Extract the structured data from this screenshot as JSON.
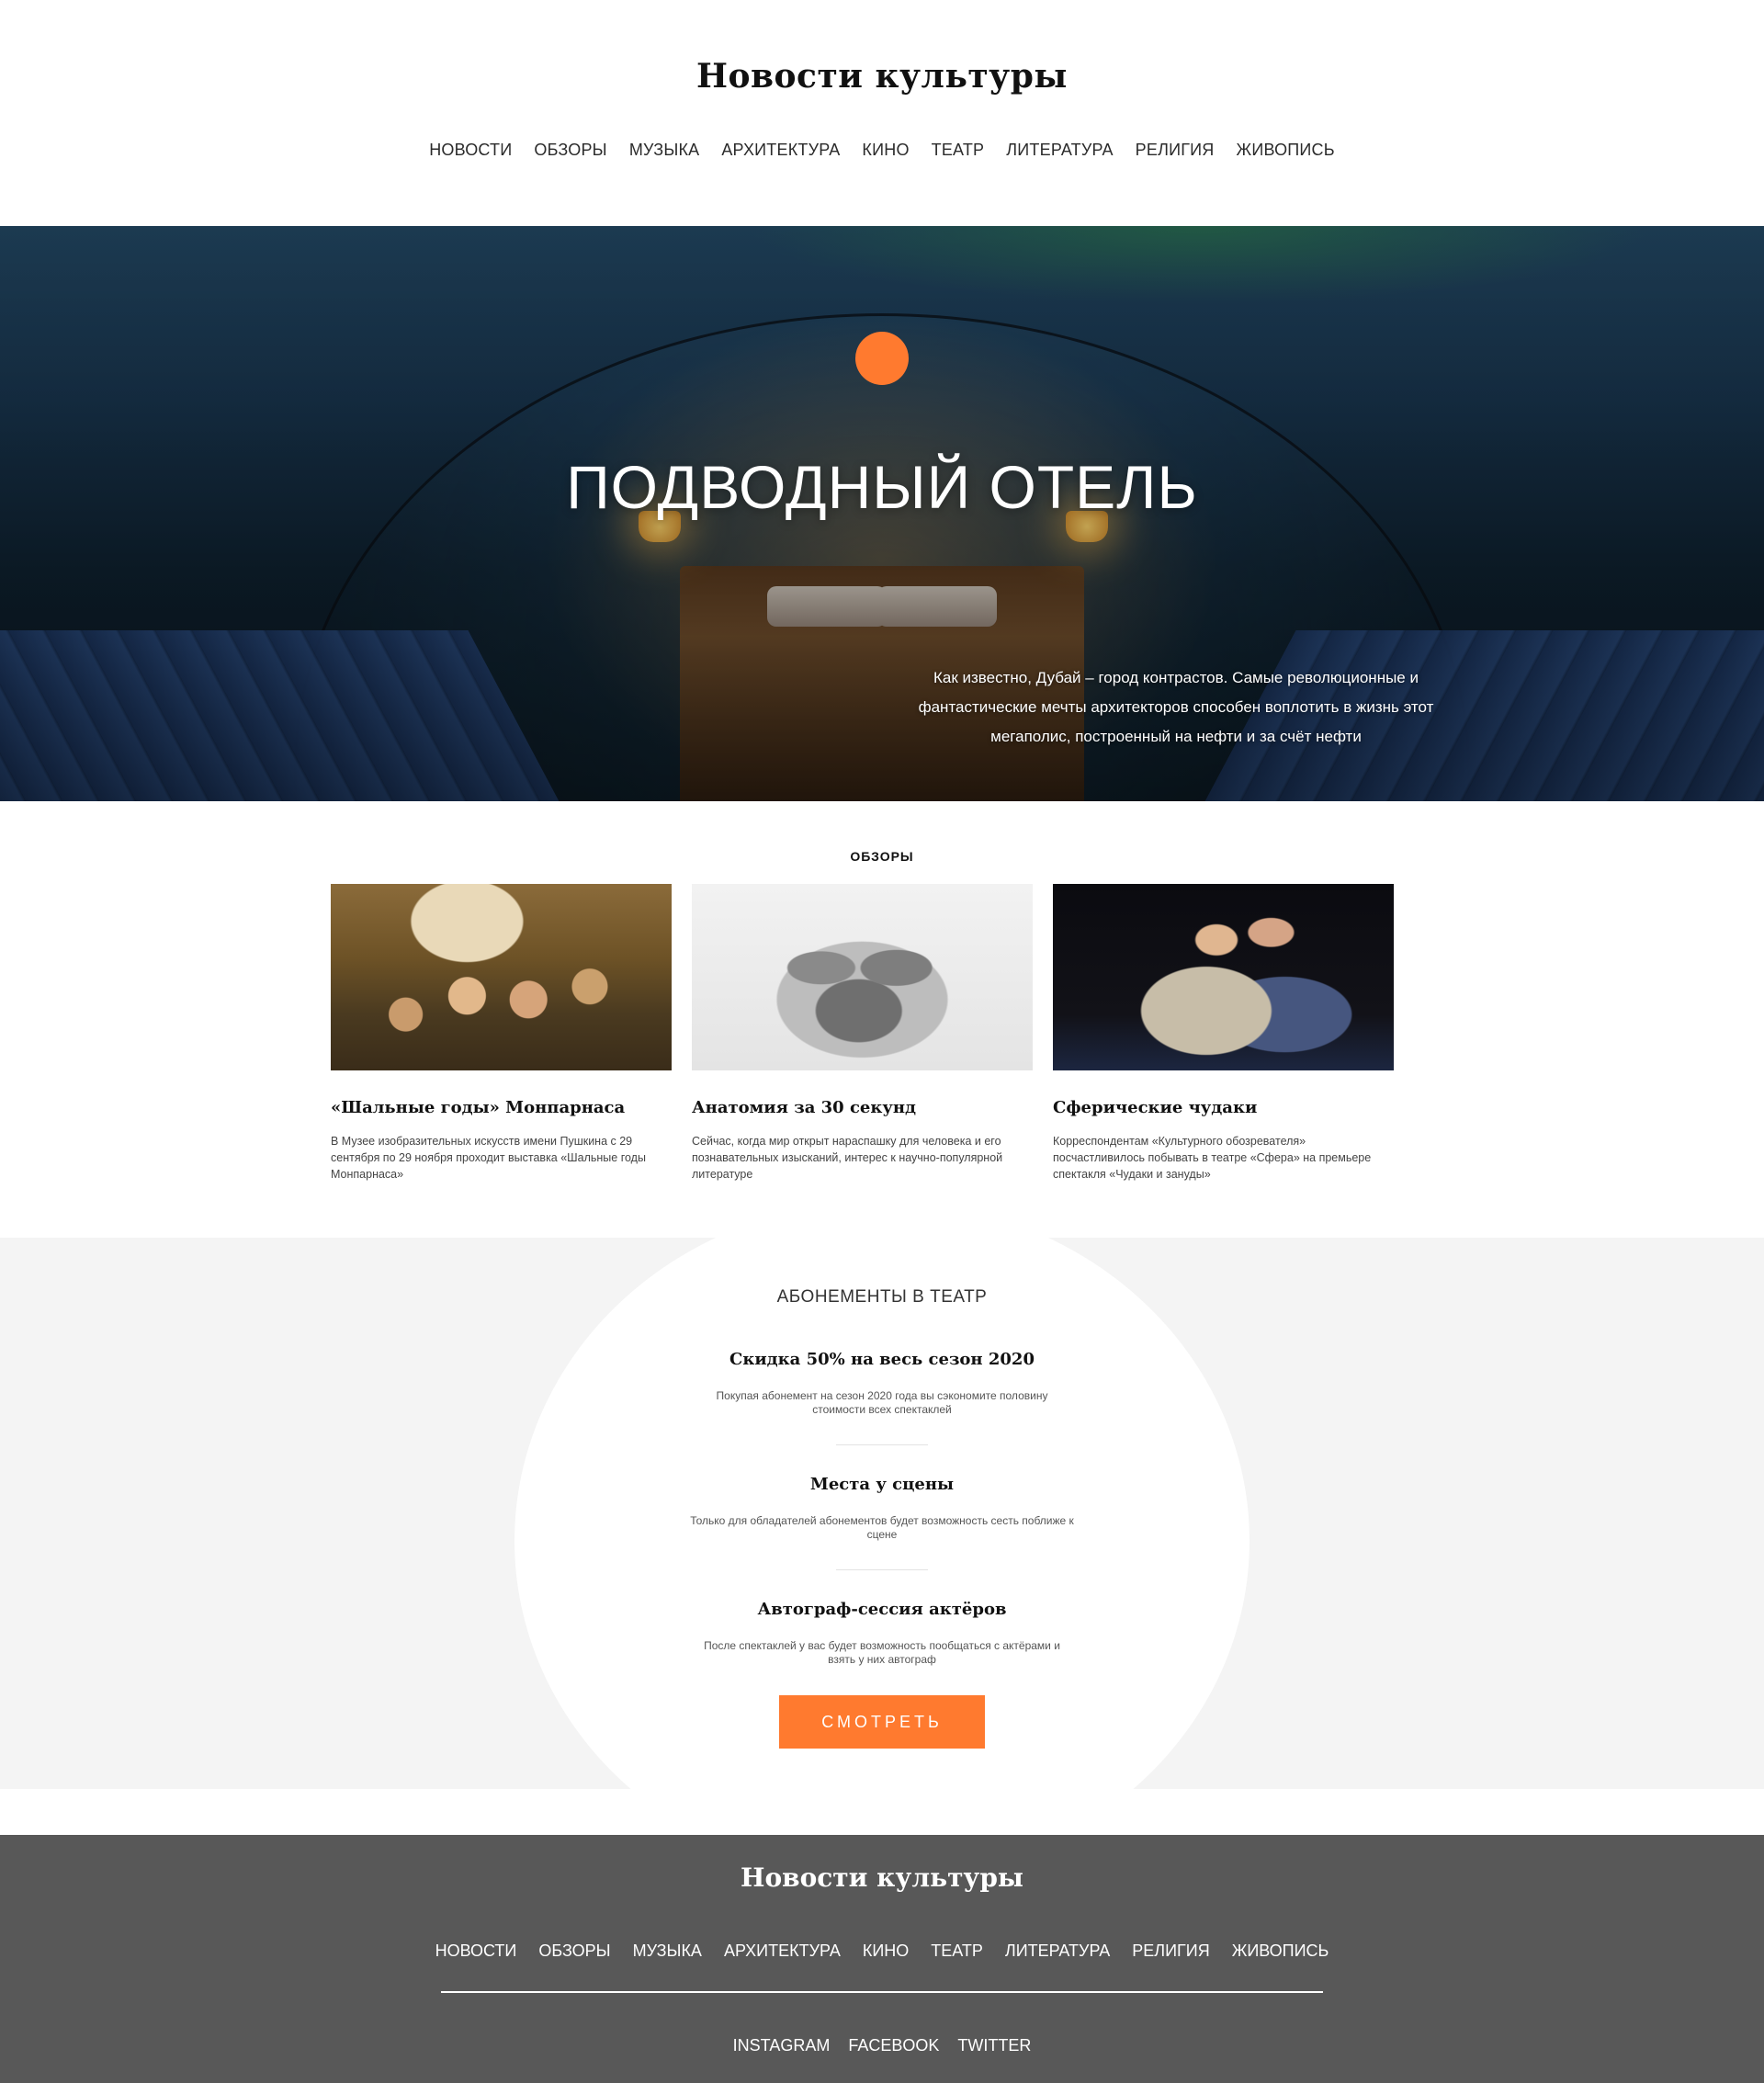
{
  "site": {
    "logo": "Новости культуры"
  },
  "nav": [
    "НОВОСТИ",
    "ОБЗОРЫ",
    "МУЗЫКА",
    "АРХИТЕКТУРА",
    "КИНО",
    "ТЕАТР",
    "ЛИТЕРАТУРА",
    "РЕЛИГИЯ",
    "ЖИВОПИСЬ"
  ],
  "hero": {
    "title": "ПОДВОДНЫЙ ОТЕЛЬ",
    "text": "Как известно, Дубай – город контрастов. Самые революционные и фантастические мечты архитекторов способен воплотить в жизнь этот мегаполис, построенный на нефти и за счёт нефти",
    "accent_color": "#ff7a2f"
  },
  "reviews": {
    "label": "ОБЗОРЫ",
    "cards": [
      {
        "title": "«Шальные годы» Монпарнаса",
        "text": "В Музее изобразительных искусств имени Пушкина с 29 сентября по 29 ноября проходит выставка «Шальные годы Монпарнаса»"
      },
      {
        "title": "Анатомия за 30 секунд",
        "text": "Сейчас, когда мир открыт нараспашку для человека и его познавательных изысканий, интерес к научно-популярной литературе"
      },
      {
        "title": "Сферические чудаки",
        "text": "Корреспондентам «Культурного обозревателя» посчастливилось побывать в театре «Сфера» на премьере спектакля «Чудаки и зануды»"
      }
    ]
  },
  "subscriptions": {
    "heading": "АБОНЕМЕНТЫ В ТЕАТР",
    "features": [
      {
        "title": "Скидка 50% на весь сезон 2020",
        "text": "Покупая абонемент на сезон 2020 года вы сэкономите половину стоимости всех спектаклей"
      },
      {
        "title": "Места у сцены",
        "text": "Только для обладателей абонементов будет возможность сесть поближе к сцене"
      },
      {
        "title": "Автограф-сессия актёров",
        "text": "После спектаклей у вас будет возможность пообщаться с актёрами и взять у них автограф"
      }
    ],
    "button": "СМОТРЕТЬ",
    "button_color": "#ff7a2f"
  },
  "footer": {
    "logo": "Новости культуры",
    "nav": [
      "НОВОСТИ",
      "ОБЗОРЫ",
      "МУЗЫКА",
      "АРХИТЕКТУРА",
      "КИНО",
      "ТЕАТР",
      "ЛИТЕРАТУРА",
      "РЕЛИГИЯ",
      "ЖИВОПИСЬ"
    ],
    "social": [
      "INSTAGRAM",
      "FACEBOOK",
      "TWITTER"
    ],
    "background": "#585858"
  }
}
